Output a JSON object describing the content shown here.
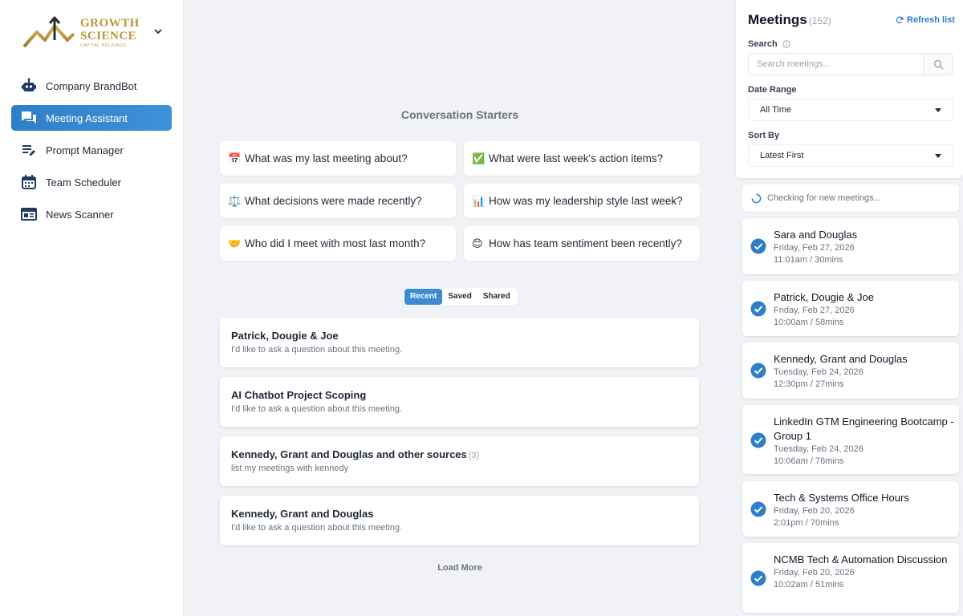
{
  "brand": {
    "line1": "GROWTH",
    "line2": "SCIENCE",
    "line3": "CAPITAL HOLDINGS",
    "color": "#b8973a"
  },
  "sidebar": {
    "items": [
      {
        "label": "Company BrandBot",
        "icon": "robot-icon"
      },
      {
        "label": "Meeting Assistant",
        "icon": "chat-bubbles-icon",
        "active": true
      },
      {
        "label": "Prompt Manager",
        "icon": "edit-list-icon"
      },
      {
        "label": "Team Scheduler",
        "icon": "calendar-icon"
      },
      {
        "label": "News Scanner",
        "icon": "newspaper-icon"
      }
    ],
    "accent": "#2f7ec9"
  },
  "main": {
    "starters_title": "Conversation Starters",
    "starters": [
      {
        "emoji": "📅",
        "text": "What was my last meeting about?"
      },
      {
        "emoji": "✅",
        "text": "What were last week's action items?"
      },
      {
        "emoji": "⚖️",
        "text": "What decisions were made recently?"
      },
      {
        "emoji": "📊",
        "text": "How was my leadership style last week?"
      },
      {
        "emoji": "🤝",
        "text": "Who did I meet with most last month?"
      },
      {
        "emoji": "😊",
        "text": "How has team sentiment been recently?"
      }
    ],
    "tabs": [
      {
        "label": "Recent",
        "active": true
      },
      {
        "label": "Saved"
      },
      {
        "label": "Shared"
      }
    ],
    "conversations": [
      {
        "title": "Patrick, Dougie & Joe",
        "count": "",
        "subtitle": "I'd like to ask a question about this meeting."
      },
      {
        "title": "AI Chatbot Project Scoping",
        "count": "",
        "subtitle": "I'd like to ask a question about this meeting."
      },
      {
        "title": "Kennedy, Grant and Douglas and other sources",
        "count": "(3)",
        "subtitle": "list my meetings with kennedy"
      },
      {
        "title": "Kennedy, Grant and Douglas",
        "count": "",
        "subtitle": "I'd like to ask a question about this meeting."
      }
    ],
    "load_more": "Load More"
  },
  "meetings": {
    "title": "Meetings",
    "count": "(152)",
    "refresh_label": "Refresh list",
    "search_label": "Search",
    "search_placeholder": "Search meetings...",
    "date_range_label": "Date Range",
    "date_range_value": "All Time",
    "sort_label": "Sort By",
    "sort_value": "Latest First",
    "checking_text": "Checking for new meetings...",
    "list": [
      {
        "name": "Sara and Douglas",
        "date": "Friday, Feb 27, 2026",
        "time": "11:01am / 30mins"
      },
      {
        "name": "Patrick, Dougie & Joe",
        "date": "Friday, Feb 27, 2026",
        "time": "10:00am / 58mins"
      },
      {
        "name": "Kennedy, Grant and Douglas",
        "date": "Tuesday, Feb 24, 2026",
        "time": "12:30pm / 27mins"
      },
      {
        "name": "LinkedIn GTM Engineering Bootcamp - Group 1",
        "date": "Tuesday, Feb 24, 2026",
        "time": "10:06am / 76mins"
      },
      {
        "name": "Tech & Systems Office Hours",
        "date": "Friday, Feb 20, 2026",
        "time": "2:01pm / 70mins"
      },
      {
        "name": "NCMB Tech & Automation Discussion",
        "date": "Friday, Feb 20, 2026",
        "time": "10:02am / 51mins"
      }
    ],
    "check_color": "#2f7ec9"
  }
}
